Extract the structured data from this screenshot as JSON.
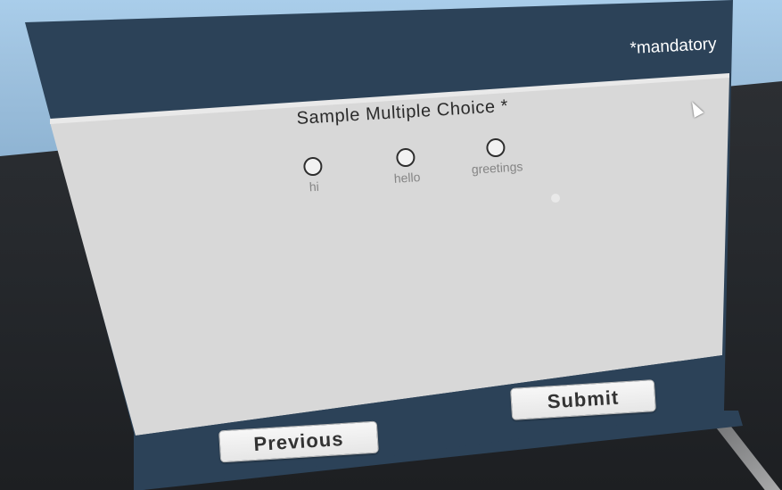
{
  "header": {
    "mandatory_note": "*mandatory"
  },
  "question": {
    "title": "Sample Multiple Choice *",
    "options": [
      {
        "label": "hi",
        "selected": false
      },
      {
        "label": "hello",
        "selected": false
      },
      {
        "label": "greetings",
        "selected": false
      }
    ]
  },
  "footer": {
    "previous_label": "Previous",
    "submit_label": "Submit"
  },
  "colors": {
    "panel_frame": "#2c4258",
    "panel_body": "#d8d8d8",
    "button_bg": "#eeeeee"
  },
  "icons": {
    "cursor": "mouse-pointer-icon",
    "pointer": "laser-dot-icon"
  }
}
